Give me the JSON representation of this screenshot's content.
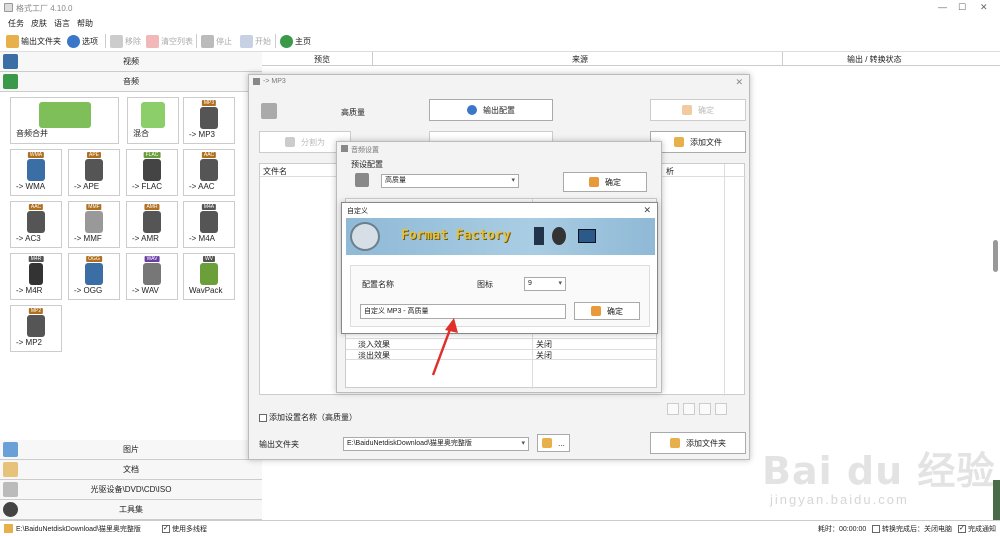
{
  "window": {
    "title": "格式工厂 4.10.0",
    "min": "—",
    "max": "☐",
    "close": "✕"
  },
  "menu": [
    "任务",
    "皮肤",
    "语言",
    "帮助"
  ],
  "toolbar": {
    "output_folder": "输出文件夹",
    "options": "选项",
    "remove": "移除",
    "clear_list": "清空列表",
    "stop": "停止",
    "start": "开始",
    "home": "主页"
  },
  "left": {
    "video": "视频",
    "audio": "音频",
    "tiles": [
      {
        "label": "音频合并",
        "badge": ""
      },
      {
        "label": "混合",
        "badge": ""
      },
      {
        "label": "-> MP3",
        "badge": "MP3"
      },
      {
        "label": "-> WMA",
        "badge": "WMA"
      },
      {
        "label": "-> APE",
        "badge": "APE"
      },
      {
        "label": "-> FLAC",
        "badge": "FLAC"
      },
      {
        "label": "-> AAC",
        "badge": "AAC"
      },
      {
        "label": "-> AC3",
        "badge": "AAC"
      },
      {
        "label": "-> MMF",
        "badge": "MMF"
      },
      {
        "label": "-> AMR",
        "badge": "AMR"
      },
      {
        "label": "-> M4A",
        "badge": "M4A"
      },
      {
        "label": "-> M4R",
        "badge": "M4R"
      },
      {
        "label": "-> OGG",
        "badge": "OGG"
      },
      {
        "label": "-> WAV",
        "badge": "WAV"
      },
      {
        "label": "WavPack",
        "badge": "WV"
      },
      {
        "label": "-> MP2",
        "badge": "MP2"
      }
    ],
    "picture": "图片",
    "document": "文档",
    "disc": "光驱设备\\DVD\\CD\\ISO",
    "tools": "工具集"
  },
  "columns": {
    "preview": "预览",
    "source": "来源",
    "output_status": "输出 / 转换状态"
  },
  "mp3_dialog": {
    "title": "-> MP3",
    "quality": "高质量",
    "output_config": "输出配置",
    "ok": "确定",
    "split": "分割为",
    "add_file": "添加文件",
    "file_name_col": "文件名",
    "add_setting_name": "添加设置名称（高质量）",
    "output_folder_label": "输出文件夹",
    "output_path": "E:\\BaiduNetdiskDownload\\猫里奥完整版",
    "browse": "...",
    "add_folder": "添加文件夹",
    "size_col": "",
    "col_frag": "析"
  },
  "audio_settings": {
    "title": "音频设置",
    "preset_label": "预设配置",
    "preset_value": "高质量",
    "ok": "确定",
    "rows": [
      {
        "name": "淡入效果",
        "value": "关闭"
      },
      {
        "name": "淡出效果",
        "value": "关闭"
      }
    ]
  },
  "custom_dialog": {
    "title": "自定义",
    "banner_text": "Format Factory",
    "config_name_label": "配置名称",
    "icon_label": "图标",
    "icon_value": "9",
    "name_value": "自定义 MP3 - 高质量",
    "ok": "确定"
  },
  "status": {
    "path": "E:\\BaiduNetdiskDownload\\猫里奥完整版",
    "multithread": "使用多线程",
    "elapsed": "耗时：00:00:00",
    "after_convert": "转换完成后：关闭电脑",
    "notify": "完成通知"
  },
  "watermark": {
    "main": "Bai du 经验",
    "sub": "jingyan.baidu.com"
  }
}
